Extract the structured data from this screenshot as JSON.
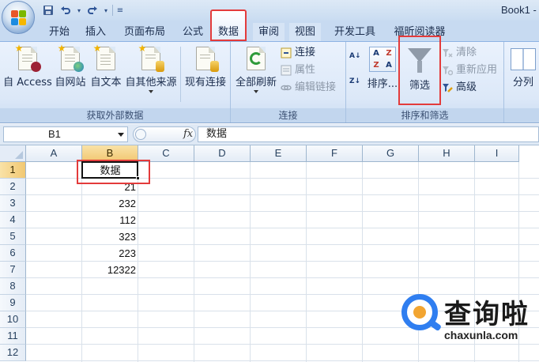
{
  "titlebar": {
    "book_title": "Book1 -",
    "qat_icons": [
      "save-icon",
      "undo-icon",
      "redo-icon",
      "customize-icon"
    ]
  },
  "tabs": [
    {
      "label": "开始"
    },
    {
      "label": "插入"
    },
    {
      "label": "页面布局"
    },
    {
      "label": "公式"
    },
    {
      "label": "数据",
      "active": true
    },
    {
      "label": "审阅"
    },
    {
      "label": "视图"
    },
    {
      "label": "开发工具"
    },
    {
      "label": "福昕阅读器"
    }
  ],
  "ribbon": {
    "external_data": {
      "group_label": "获取外部数据",
      "from_access": "自 Access",
      "from_web": "自网站",
      "from_text": "自文本",
      "from_other": "自其他来源",
      "existing_connections": "现有连接"
    },
    "connections": {
      "group_label": "连接",
      "refresh_all": "全部刷新",
      "connections": "连接",
      "properties": "属性",
      "edit_links": "编辑链接"
    },
    "sort_filter": {
      "group_label": "排序和筛选",
      "sort": "排序...",
      "filter": "筛选",
      "clear": "清除",
      "reapply": "重新应用",
      "advanced": "高级",
      "sort_az_glyph": "A↓",
      "sort_za_glyph": "Z↓"
    },
    "data_tools": {
      "text_to_columns": "分列"
    }
  },
  "formula_bar": {
    "name_box": "B1",
    "fx": "fx",
    "formula": "数据"
  },
  "sheet": {
    "columns": [
      "A",
      "B",
      "C",
      "D",
      "E",
      "F",
      "G",
      "H",
      "I"
    ],
    "rows": [
      "1",
      "2",
      "3",
      "4",
      "5",
      "6",
      "7",
      "8",
      "9",
      "10",
      "11",
      "12"
    ],
    "column_b_values": [
      "数据",
      "21",
      "232",
      "112",
      "323",
      "223",
      "12322"
    ],
    "selected_cell": "B1"
  },
  "watermark": {
    "text": "查询啦",
    "url": "chaxunla.com"
  },
  "colors": {
    "highlight_red": "#e33b3b",
    "selected_header": "#f2c872",
    "ribbon_blue": "#dce8f8"
  }
}
